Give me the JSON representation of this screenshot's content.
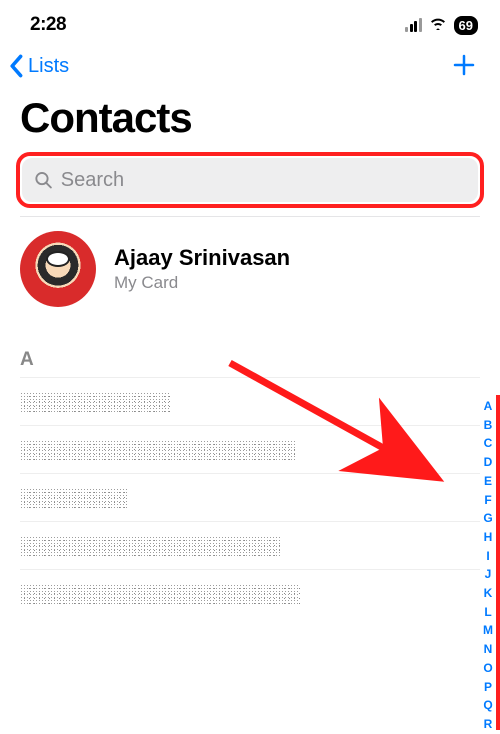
{
  "status": {
    "time": "2:28",
    "battery": "69"
  },
  "nav": {
    "back_label": "Lists"
  },
  "title": "Contacts",
  "search": {
    "placeholder": "Search"
  },
  "my_card": {
    "name": "Ajaay Srinivasan",
    "subtitle": "My Card"
  },
  "section": "A",
  "index_letters": [
    "A",
    "B",
    "C",
    "D",
    "E",
    "F",
    "G",
    "H",
    "I",
    "J",
    "K",
    "L",
    "M",
    "N",
    "O",
    "P",
    "Q",
    "R"
  ]
}
